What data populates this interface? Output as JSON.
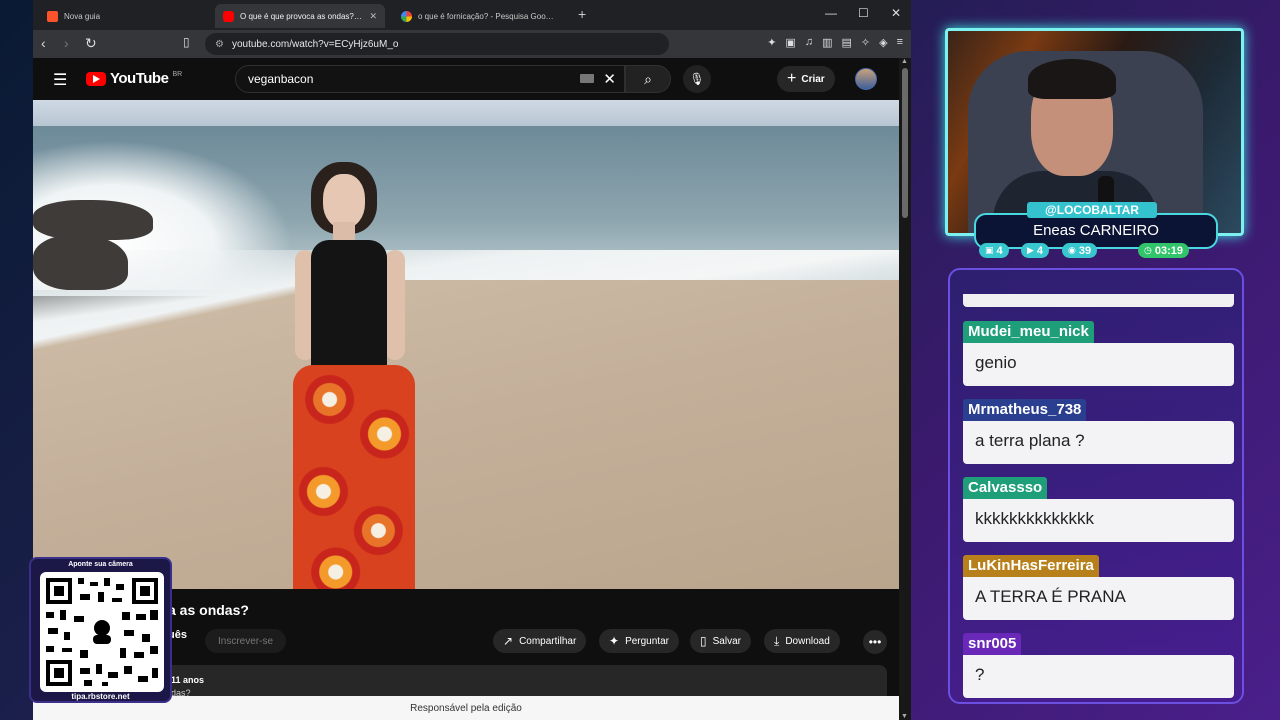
{
  "browser": {
    "tabs": [
      {
        "title": "Nova guia",
        "active": false
      },
      {
        "title": "O que é que provoca as ondas? - YouTube",
        "active": true
      },
      {
        "title": "o que é fornicação? - Pesquisa Google",
        "active": false
      }
    ],
    "url": "youtube.com/watch?v=ECyHjz6uM_o"
  },
  "youtube": {
    "logo_text": "YouTube",
    "country": "BR",
    "search_value": "veganbacon",
    "create_label": "Criar",
    "video_title_partial": "a as ondas?",
    "channel_partial": "uês",
    "subscribe_label": "Inscrever-se",
    "actions": {
      "share": "Compartilhar",
      "ask": "Perguntar",
      "save": "Salvar",
      "download": "Download"
    },
    "description_line1": "11 anos",
    "description_line2": "das?",
    "footer_text": "Responsável pela edição"
  },
  "qr": {
    "caption": "Aponte sua câmera",
    "url": "tipa.rbstore.net"
  },
  "stream": {
    "handle": "@LOCOBALTAR",
    "name": "Eneas CARNEIRO",
    "stats": {
      "twitch": "4",
      "youtube": "4",
      "kick": "39",
      "time": "03:19"
    }
  },
  "chat": [
    {
      "user": "Mudei_meu_nick",
      "text": "genio",
      "color": "#1f9e7a"
    },
    {
      "user": "Mrmatheus_738",
      "text": "a terra plana ?",
      "color": "#2a3f8f"
    },
    {
      "user": "Calvassso",
      "text": "kkkkkkkkkkkkkk",
      "color": "#1f9e7a"
    },
    {
      "user": "LuKinHasFerreira",
      "text": "A TERRA É PRANA",
      "color": "#b8801a"
    },
    {
      "user": "snr005",
      "text": "?",
      "color": "#6a28b8"
    }
  ]
}
